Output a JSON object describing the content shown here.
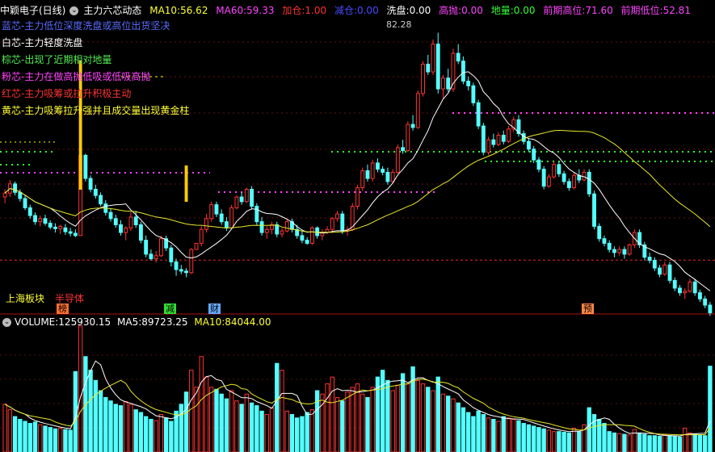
{
  "header": {
    "stock_name": "中颖电子(日线)",
    "indicator_name": "主力六芯动态",
    "ma10_label": "MA10:",
    "ma10_value": "56.62",
    "ma60_label": "MA60:",
    "ma60_value": "59.33",
    "jiacang_label": "加仓:",
    "jiacang_value": "1.00",
    "jiancang_label": "减仓:",
    "jiancang_value": "0.00",
    "xipan_label": "洗盘:",
    "xipan_value": "0.00",
    "gaopao_label": "高抛:",
    "gaopao_value": "0.00",
    "diliang_label": "地量:",
    "diliang_value": "0.00",
    "qiqigaowei_label": "前期高位:",
    "qiqigaowei_value": "71.60",
    "qiqidiwei_label": "前期低位:",
    "qiqidiwei_value": "52.81"
  },
  "legend": [
    {
      "text": "蓝芯-主力低位深度洗盘或高位出货坚决",
      "color": "#5a6bff"
    },
    {
      "text": "白芯-主力轻度洗盘",
      "color": "#ffffff"
    },
    {
      "text": "棕芯-出现了近期相对地量",
      "color": "#55ee55"
    },
    {
      "text": "粉芯-主力在做高抛低吸或低吸高抛",
      "color": "#ff44ff"
    },
    {
      "text": "红芯-主力吸筹或拉升积极主动",
      "color": "#ff3333"
    },
    {
      "text": "黄芯-主力吸筹拉升强并且成交量出现黄金柱",
      "color": "#ffff33"
    }
  ],
  "peak_label": "82.28",
  "sector": {
    "board": "上海板块",
    "industry": "半导体"
  },
  "tags": [
    "榜",
    "减",
    "财",
    "预"
  ],
  "volume_header": {
    "vol_label": "VOLUME:",
    "vol_value": "125930.15",
    "ma5_label": "MA5:",
    "ma5_value": "89723.25",
    "ma10_label": "MA10:",
    "ma10_value": "84044.00"
  },
  "colors": {
    "up": "#ff3333",
    "down": "#54ffff",
    "ma10": "#ffffff",
    "ma60": "#e8e82a",
    "pink": "#ff44ff",
    "green": "#33ff33",
    "yellow": "#ffff00",
    "red_dash": "#cc2222"
  },
  "chart_data": {
    "type": "candlestick",
    "price_range": [
      47,
      84
    ],
    "reference_levels": [
      {
        "name": "前期高位",
        "value": 71.6
      },
      {
        "name": "前期低位",
        "value": 52.81
      }
    ],
    "ohlc": [
      [
        61.0,
        62.0,
        60.2,
        61.5
      ],
      [
        61.5,
        63.2,
        61.0,
        62.7
      ],
      [
        62.7,
        63.0,
        61.2,
        61.6
      ],
      [
        61.6,
        62.0,
        60.4,
        60.8
      ],
      [
        60.8,
        61.2,
        59.3,
        59.6
      ],
      [
        59.6,
        60.0,
        58.2,
        58.6
      ],
      [
        58.6,
        59.0,
        57.4,
        57.8
      ],
      [
        57.8,
        58.6,
        57.2,
        58.2
      ],
      [
        58.2,
        58.7,
        57.3,
        57.6
      ],
      [
        57.6,
        58.0,
        56.8,
        57.1
      ],
      [
        57.1,
        57.6,
        56.4,
        56.9
      ],
      [
        56.9,
        57.4,
        56.2,
        57.2
      ],
      [
        57.0,
        57.5,
        56.1,
        56.5
      ],
      [
        56.5,
        57.0,
        55.9,
        56.3
      ],
      [
        56.3,
        56.8,
        55.8,
        56.0
      ],
      [
        56.0,
        67.0,
        56.0,
        66.4
      ],
      [
        66.4,
        66.6,
        63.0,
        63.4
      ],
      [
        63.4,
        63.8,
        61.6,
        62.0
      ],
      [
        62.0,
        62.6,
        60.8,
        61.2
      ],
      [
        61.2,
        61.6,
        59.8,
        60.1
      ],
      [
        60.1,
        60.6,
        58.6,
        59.0
      ],
      [
        59.0,
        59.5,
        57.8,
        58.2
      ],
      [
        58.2,
        58.7,
        57.0,
        57.4
      ],
      [
        57.4,
        58.0,
        56.0,
        56.4
      ],
      [
        56.4,
        57.2,
        55.4,
        57.0
      ],
      [
        57.0,
        59.0,
        56.6,
        58.4
      ],
      [
        58.4,
        59.2,
        57.0,
        57.4
      ],
      [
        57.4,
        57.8,
        55.0,
        55.4
      ],
      [
        55.4,
        56.0,
        53.2,
        53.6
      ],
      [
        53.6,
        54.2,
        52.8,
        53.0
      ],
      [
        53.0,
        54.0,
        52.5,
        53.4
      ],
      [
        53.4,
        56.0,
        53.2,
        55.6
      ],
      [
        55.6,
        56.0,
        54.0,
        54.4
      ],
      [
        54.4,
        54.8,
        52.0,
        52.6
      ],
      [
        52.6,
        53.0,
        50.8,
        51.6
      ],
      [
        51.6,
        52.2,
        51.0,
        51.4
      ],
      [
        51.4,
        51.8,
        50.6,
        51.2
      ],
      [
        51.2,
        54.4,
        51.0,
        54.2
      ],
      [
        54.2,
        55.0,
        54.2,
        55.0
      ],
      [
        55.0,
        57.2,
        54.6,
        56.8
      ],
      [
        56.8,
        58.8,
        56.4,
        58.2
      ],
      [
        58.2,
        60.4,
        57.8,
        60.0
      ],
      [
        60.0,
        60.4,
        58.4,
        58.8
      ],
      [
        58.8,
        59.4,
        57.4,
        57.8
      ],
      [
        57.8,
        58.4,
        56.6,
        57.0
      ],
      [
        57.0,
        60.0,
        56.8,
        59.6
      ],
      [
        59.6,
        61.2,
        59.4,
        61.0
      ],
      [
        61.0,
        61.6,
        60.0,
        60.4
      ],
      [
        60.4,
        62.2,
        60.2,
        62.0
      ],
      [
        62.0,
        62.4,
        59.4,
        59.8
      ],
      [
        59.8,
        60.2,
        57.4,
        57.8
      ],
      [
        57.8,
        58.4,
        56.0,
        56.4
      ],
      [
        56.4,
        57.2,
        55.6,
        56.8
      ],
      [
        56.8,
        57.8,
        56.2,
        57.4
      ],
      [
        57.4,
        57.8,
        55.8,
        56.2
      ],
      [
        56.2,
        57.0,
        55.8,
        56.6
      ],
      [
        56.6,
        58.2,
        56.4,
        57.8
      ],
      [
        57.8,
        58.2,
        56.4,
        56.8
      ],
      [
        56.8,
        57.4,
        55.6,
        56.0
      ],
      [
        56.0,
        56.6,
        55.0,
        55.4
      ],
      [
        55.4,
        55.8,
        54.8,
        55.0
      ],
      [
        55.0,
        57.2,
        54.8,
        57.0
      ],
      [
        57.0,
        57.2,
        55.6,
        56.0
      ],
      [
        56.0,
        56.8,
        55.4,
        56.4
      ],
      [
        56.4,
        57.2,
        56.2,
        56.8
      ],
      [
        56.8,
        58.4,
        56.4,
        58.2
      ],
      [
        58.2,
        59.2,
        57.8,
        58.8
      ],
      [
        58.8,
        59.2,
        56.2,
        56.6
      ],
      [
        56.6,
        57.2,
        56.0,
        56.8
      ],
      [
        56.8,
        60.2,
        56.6,
        59.8
      ],
      [
        59.8,
        62.6,
        59.4,
        62.2
      ],
      [
        62.2,
        64.8,
        61.8,
        64.4
      ],
      [
        64.4,
        65.2,
        63.0,
        63.4
      ],
      [
        63.4,
        65.8,
        63.0,
        65.4
      ],
      [
        65.4,
        66.0,
        64.2,
        64.6
      ],
      [
        64.6,
        65.0,
        63.8,
        64.2
      ],
      [
        64.2,
        64.8,
        62.6,
        63.0
      ],
      [
        63.0,
        64.6,
        62.8,
        64.2
      ],
      [
        64.2,
        67.8,
        64.0,
        67.4
      ],
      [
        67.4,
        68.4,
        66.6,
        67.0
      ],
      [
        67.0,
        70.8,
        66.8,
        70.4
      ],
      [
        70.4,
        71.6,
        69.6,
        70.0
      ],
      [
        70.0,
        74.8,
        69.8,
        74.4
      ],
      [
        74.4,
        78.6,
        74.0,
        78.2
      ],
      [
        78.2,
        79.4,
        76.8,
        77.2
      ],
      [
        77.2,
        81.4,
        76.8,
        80.8
      ],
      [
        80.8,
        82.28,
        74.4,
        75.0
      ],
      [
        75.0,
        76.8,
        73.8,
        76.4
      ],
      [
        76.4,
        77.6,
        74.6,
        75.0
      ],
      [
        75.0,
        80.2,
        74.6,
        79.6
      ],
      [
        79.6,
        80.8,
        78.2,
        78.6
      ],
      [
        78.6,
        79.2,
        75.6,
        76.0
      ],
      [
        76.0,
        76.6,
        74.8,
        75.4
      ],
      [
        75.4,
        75.8,
        72.8,
        73.2
      ],
      [
        73.2,
        73.6,
        69.8,
        70.2
      ],
      [
        70.2,
        70.6,
        66.4,
        66.8
      ],
      [
        66.8,
        68.8,
        66.4,
        68.4
      ],
      [
        68.4,
        69.2,
        67.4,
        67.8
      ],
      [
        67.8,
        69.4,
        67.6,
        69.0
      ],
      [
        69.0,
        69.6,
        67.8,
        68.2
      ],
      [
        68.2,
        70.2,
        68.0,
        69.8
      ],
      [
        69.8,
        71.4,
        69.4,
        71.0
      ],
      [
        71.0,
        71.6,
        68.8,
        69.2
      ],
      [
        69.2,
        69.6,
        67.8,
        68.2
      ],
      [
        68.2,
        68.6,
        66.8,
        67.2
      ],
      [
        67.2,
        67.6,
        65.4,
        65.8
      ],
      [
        65.8,
        66.2,
        64.2,
        64.6
      ],
      [
        64.6,
        65.0,
        62.0,
        62.4
      ],
      [
        62.4,
        64.0,
        62.2,
        63.6
      ],
      [
        63.6,
        65.6,
        63.4,
        65.2
      ],
      [
        65.2,
        65.6,
        63.6,
        64.0
      ],
      [
        64.0,
        64.4,
        62.6,
        63.0
      ],
      [
        63.0,
        63.4,
        61.8,
        62.2
      ],
      [
        62.2,
        64.2,
        62.0,
        63.8
      ],
      [
        63.8,
        64.6,
        62.8,
        63.2
      ],
      [
        63.2,
        64.6,
        63.0,
        64.2
      ],
      [
        64.2,
        64.6,
        61.0,
        61.4
      ],
      [
        61.4,
        61.8,
        56.8,
        57.2
      ],
      [
        57.2,
        57.6,
        55.2,
        55.6
      ],
      [
        55.6,
        56.0,
        54.6,
        55.0
      ],
      [
        55.0,
        55.4,
        53.8,
        54.2
      ],
      [
        54.2,
        54.6,
        53.2,
        53.8
      ],
      [
        53.8,
        54.6,
        53.4,
        54.2
      ],
      [
        54.2,
        54.6,
        53.0,
        53.6
      ],
      [
        53.6,
        55.0,
        53.4,
        54.8
      ],
      [
        54.8,
        56.8,
        54.4,
        56.4
      ],
      [
        56.4,
        56.8,
        54.4,
        54.8
      ],
      [
        54.8,
        55.2,
        52.8,
        53.2
      ],
      [
        53.2,
        53.8,
        52.4,
        52.8
      ],
      [
        52.8,
        53.2,
        51.4,
        51.8
      ],
      [
        51.8,
        52.2,
        50.6,
        51.0
      ],
      [
        51.0,
        52.6,
        50.8,
        52.2
      ],
      [
        52.2,
        52.6,
        49.8,
        50.2
      ],
      [
        50.2,
        50.6,
        48.8,
        49.2
      ],
      [
        49.2,
        49.6,
        48.2,
        48.6
      ],
      [
        48.6,
        49.2,
        47.8,
        48.8
      ],
      [
        48.8,
        50.4,
        48.6,
        50.0
      ],
      [
        50.0,
        50.4,
        48.2,
        48.6
      ],
      [
        48.6,
        49.0,
        47.4,
        47.8
      ],
      [
        47.8,
        48.2,
        46.6,
        47.0
      ],
      [
        47.0,
        47.4,
        45.6,
        46.0
      ]
    ],
    "volume_range": [
      0,
      180000
    ],
    "volume": [
      70000,
      62000,
      52000,
      48000,
      45000,
      42000,
      44000,
      40000,
      38000,
      36000,
      34000,
      35000,
      33000,
      32000,
      118000,
      185000,
      140000,
      120000,
      105000,
      90000,
      80000,
      75000,
      70000,
      68000,
      74000,
      70000,
      62000,
      58000,
      52000,
      48000,
      46000,
      55000,
      50000,
      45000,
      60000,
      70000,
      88000,
      120000,
      95000,
      140000,
      110000,
      95000,
      92000,
      85000,
      78000,
      90000,
      75000,
      70000,
      85000,
      72000,
      68000,
      60000,
      55000,
      65000,
      130000,
      120000,
      60000,
      55000,
      50000,
      52000,
      58000,
      62000,
      90000,
      85000,
      100000,
      110000,
      80000,
      75000,
      88000,
      95000,
      100000,
      85000,
      80000,
      95000,
      110000,
      120000,
      105000,
      90000,
      98000,
      115000,
      100000,
      125000,
      105000,
      100000,
      95000,
      90000,
      110000,
      85000,
      82000,
      78000,
      72000,
      65000,
      58000,
      52000,
      60000,
      55000,
      50000,
      48000,
      45000,
      52000,
      50000,
      48000,
      46000,
      42000,
      40000,
      38000,
      36000,
      34000,
      32000,
      30000,
      30000,
      29000,
      28000,
      35000,
      30000,
      40000,
      65000,
      55000,
      48000,
      42000,
      30000,
      28000,
      27000,
      26000,
      25000,
      33000,
      28000,
      26000,
      24000,
      24000,
      23000,
      25000,
      24000,
      23000,
      22000,
      35000,
      28000,
      26000,
      25000,
      24000,
      125930
    ]
  }
}
